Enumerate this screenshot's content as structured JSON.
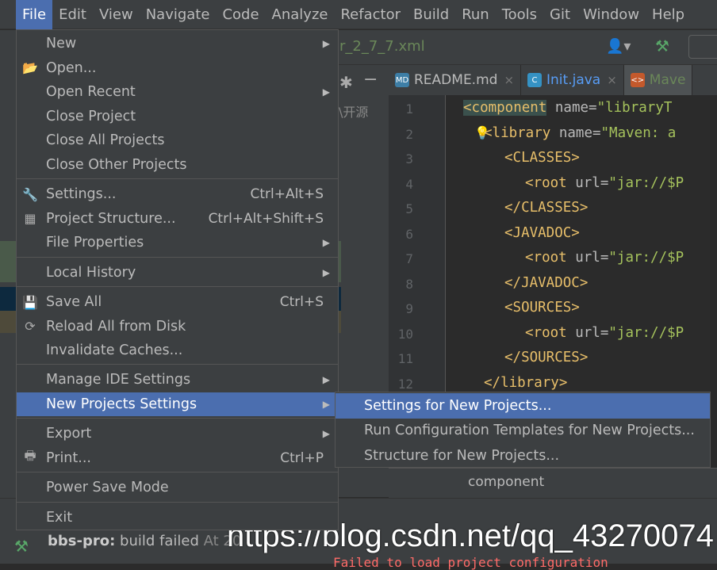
{
  "menubar": [
    "File",
    "Edit",
    "View",
    "Navigate",
    "Code",
    "Analyze",
    "Refactor",
    "Build",
    "Run",
    "Tools",
    "Git",
    "Window",
    "Help"
  ],
  "breadcrumb": "r_2_7_7.xml",
  "tabs": [
    {
      "label": "README.md",
      "icon": "md-file-icon",
      "color": "#bbbbbb"
    },
    {
      "label": "Init.java",
      "icon": "java-class-icon",
      "color": "#589df6"
    },
    {
      "label": "Mave",
      "icon": "xml-file-icon",
      "color": "#6a8759"
    }
  ],
  "project_snippet": "\\开源",
  "line_numbers": [
    "1",
    "2",
    "3",
    "4",
    "5",
    "6",
    "7",
    "8",
    "9",
    "10",
    "11",
    "12"
  ],
  "code": [
    {
      "tag": "<component",
      "attr": " name=",
      "val": "\"libraryT"
    },
    {
      "tag": "<library",
      "attr": " name=",
      "val": "\"Maven: a"
    },
    {
      "tag": "<CLASSES>",
      "attr": "",
      "val": ""
    },
    {
      "tag": "<root",
      "attr": " url=",
      "val": "\"jar://$P"
    },
    {
      "tag": "</CLASSES>",
      "attr": "",
      "val": ""
    },
    {
      "tag": "<JAVADOC>",
      "attr": "",
      "val": ""
    },
    {
      "tag": "<root",
      "attr": " url=",
      "val": "\"jar://$P"
    },
    {
      "tag": "</JAVADOC>",
      "attr": "",
      "val": ""
    },
    {
      "tag": "<SOURCES>",
      "attr": "",
      "val": ""
    },
    {
      "tag": "<root",
      "attr": " url=",
      "val": "\"jar://$P"
    },
    {
      "tag": "</SOURCES>",
      "attr": "",
      "val": ""
    },
    {
      "tag": "</library>",
      "attr": "",
      "val": ""
    }
  ],
  "file_menu": [
    {
      "label": "New",
      "submenu": true
    },
    {
      "label": "Open...",
      "icon": "folder-open-icon"
    },
    {
      "label": "Open Recent",
      "submenu": true
    },
    {
      "label": "Close Project"
    },
    {
      "label": "Close All Projects"
    },
    {
      "label": "Close Other Projects"
    },
    {
      "sep": true
    },
    {
      "label": "Settings...",
      "shortcut": "Ctrl+Alt+S",
      "icon": "wrench-icon"
    },
    {
      "label": "Project Structure...",
      "shortcut": "Ctrl+Alt+Shift+S",
      "icon": "project-structure-icon"
    },
    {
      "label": "File Properties",
      "submenu": true
    },
    {
      "sep": true
    },
    {
      "label": "Local History",
      "submenu": true
    },
    {
      "sep": true
    },
    {
      "label": "Save All",
      "shortcut": "Ctrl+S",
      "icon": "save-icon"
    },
    {
      "label": "Reload All from Disk",
      "icon": "reload-icon"
    },
    {
      "label": "Invalidate Caches..."
    },
    {
      "sep": true
    },
    {
      "label": "Manage IDE Settings",
      "submenu": true
    },
    {
      "label": "New Projects Settings",
      "submenu": true,
      "highlighted": true
    },
    {
      "sep": true
    },
    {
      "label": "Export",
      "submenu": true
    },
    {
      "label": "Print...",
      "shortcut": "Ctrl+P",
      "icon": "print-icon"
    },
    {
      "sep": true
    },
    {
      "label": "Power Save Mode"
    },
    {
      "sep": true
    },
    {
      "label": "Exit"
    }
  ],
  "submenu": [
    {
      "label": "Settings for New Projects...",
      "highlighted": true
    },
    {
      "label": "Run Configuration Templates for New Projects..."
    },
    {
      "label": "Structure for New Projects..."
    }
  ],
  "breadcrumb_bottom": "component",
  "build": {
    "project": "bbs-pro:",
    "status": "build failed",
    "time": "At 20"
  },
  "error_text": "Failed to load project configuration",
  "watermark": "https://blog.csdn.net/qq_43270074",
  "accent": "#4b6eaf"
}
